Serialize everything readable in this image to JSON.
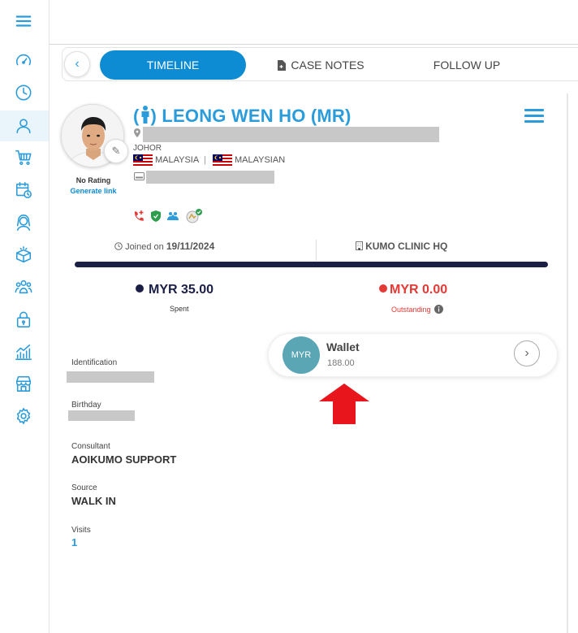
{
  "sidebar": {
    "items": [
      {
        "icon": "hamburger-menu-icon"
      },
      {
        "icon": "speedometer-icon"
      },
      {
        "icon": "clock-icon"
      },
      {
        "icon": "user-icon",
        "active": true
      },
      {
        "icon": "cart-icon"
      },
      {
        "icon": "calendar-clock-icon"
      },
      {
        "icon": "person-hair-icon"
      },
      {
        "icon": "box-icon"
      },
      {
        "icon": "group-icon"
      },
      {
        "icon": "lock-icon"
      },
      {
        "icon": "chart-icon"
      },
      {
        "icon": "store-icon"
      },
      {
        "icon": "gear-icon"
      }
    ],
    "accent": "#2b9cdb"
  },
  "tabs": {
    "back": "‹",
    "items": [
      {
        "label": "TIMELINE",
        "active": true
      },
      {
        "label": "CASE NOTES",
        "icon": "document-icon"
      },
      {
        "label": "FOLLOW UP"
      }
    ],
    "active_color": "#0d8bd3"
  },
  "profile": {
    "name": "LEONG WEN HO (MR)",
    "rating": "No Rating",
    "rating_link": "Generate link",
    "state": "JOHOR",
    "country": "MALAYSIA",
    "nationality": "MALAYSIAN",
    "separator": "|"
  },
  "stats": {
    "joined_prefix": "Joined on",
    "joined_date": "19/11/2024",
    "clinic": "KUMO CLINIC HQ",
    "spent_amount": "MYR 35.00",
    "spent_label": "Spent",
    "outstanding_amount": "MYR 0.00",
    "outstanding_label": "Outstanding",
    "spent_color": "#1b1f45",
    "outstanding_color": "#e53935"
  },
  "details": {
    "identification_label": "Identification",
    "birthday_label": "Birthday",
    "consultant_label": "Consultant",
    "consultant_value": "AOIKUMO SUPPORT",
    "source_label": "Source",
    "source_value": "WALK IN",
    "visits_label": "Visits",
    "visits_value": "1"
  },
  "wallet": {
    "currency": "MYR",
    "title": "Wallet",
    "balance": "188.00"
  }
}
